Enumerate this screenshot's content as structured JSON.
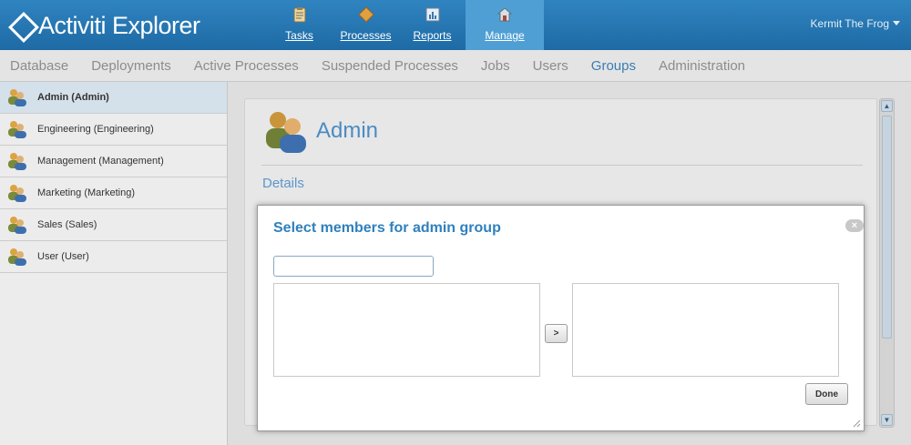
{
  "header": {
    "logo_text": "Activiti Explorer",
    "nav": [
      {
        "label": "Tasks",
        "icon": "clipboard-icon"
      },
      {
        "label": "Processes",
        "icon": "diamond-icon"
      },
      {
        "label": "Reports",
        "icon": "chart-icon"
      },
      {
        "label": "Manage",
        "icon": "house-icon"
      }
    ],
    "active_nav": "Manage",
    "user_name": "Kermit The Frog"
  },
  "subnav": {
    "items": [
      "Database",
      "Deployments",
      "Active Processes",
      "Suspended Processes",
      "Jobs",
      "Users",
      "Groups",
      "Administration"
    ],
    "active": "Groups"
  },
  "groups": {
    "items": [
      {
        "label": "Admin (Admin)"
      },
      {
        "label": "Engineering (Engineering)"
      },
      {
        "label": "Management (Management)"
      },
      {
        "label": "Marketing (Marketing)"
      },
      {
        "label": "Sales (Sales)"
      },
      {
        "label": "User (User)"
      }
    ],
    "selected": "Admin (Admin)"
  },
  "details": {
    "title": "Admin",
    "section_label": "Details"
  },
  "modal": {
    "title": "Select members for admin group",
    "search_value": "",
    "move_label": ">",
    "done_label": "Done",
    "close_label": "×"
  },
  "colors": {
    "header_blue": "#1e6aa5",
    "accent_blue": "#2f80bd",
    "selected_row": "#d4e0ea"
  }
}
